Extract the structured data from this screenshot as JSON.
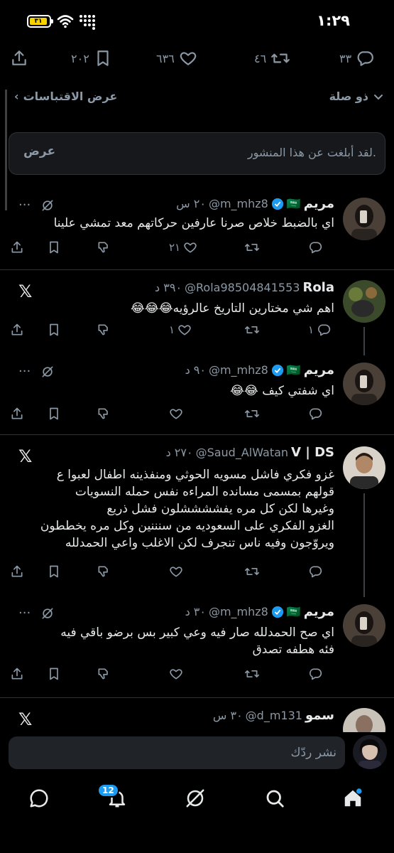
{
  "status_bar": {
    "time": "١:٢٩",
    "battery": "٣١"
  },
  "action_bar": {
    "replies": "٣٣",
    "reposts": "٤٦",
    "likes": "٦٣٦",
    "bookmarks": "٢٠٢"
  },
  "quote_header": {
    "left": "ذو صلة",
    "right": "عرض الاقتباسات"
  },
  "report_notice": {
    "message": "لقد أبلغت عن هذا المنشور.",
    "view": "عرض"
  },
  "tweets": [
    {
      "name": "مريم",
      "flag": "🇸🇦",
      "handle": "@m_mhz8",
      "time": "٢٠ س",
      "text": "اي بالضبط خلاص صرنا عارفين حركاتهم معد تمشي علينا",
      "likes": "٢١"
    },
    {
      "name": "Rola",
      "handle": "@Rola98504841553",
      "time": "٣٩٠ د",
      "text": "اهم شي مختارين التاريخ عالرؤيه😂😂😂",
      "likes": "١",
      "replies": "١"
    },
    {
      "name": "مريم",
      "flag": "🇸🇦",
      "handle": "@m_mhz8",
      "time": "٩٠ د",
      "text": "اي شفتي كيف 😂😂"
    },
    {
      "name": "V | DS",
      "handle": "@Saud_AlWatan",
      "time": "٢٧٠ د",
      "text": "غزو فكري فاشل مسويه الحوثي ومنفذينه اطفال لعبوا ع\nقولهم بمسمى مسانده المراءه نفس حمله النسويات\nوغيرها لكن كل مره يفششششلون فشل ذريع\nالغزو الفكري على السعوديه من سنننين وكل مره يخططون\nويروّجون وفيه ناس تنجرف لكن الاغلب واعي الحمدلله"
    },
    {
      "name": "مريم",
      "flag": "🇸🇦",
      "handle": "@m_mhz8",
      "time": "٣٠ د",
      "text": "اي صح الحمدلله صار فيه وعي كبير بس برضو باقي فيه\nفئه هطفه تصدق"
    },
    {
      "name": "سمو",
      "handle": "@d_m131",
      "time": "٣٠ س"
    }
  ],
  "reply_bar": {
    "placeholder": "نشر ردّك"
  },
  "nav": {
    "notifications_badge": "12"
  },
  "colors": {
    "background": "#000000",
    "text": "#e7e9ea",
    "muted": "#8b98a5",
    "accent": "#1d9bf0",
    "verified": "#1d9bf0"
  }
}
